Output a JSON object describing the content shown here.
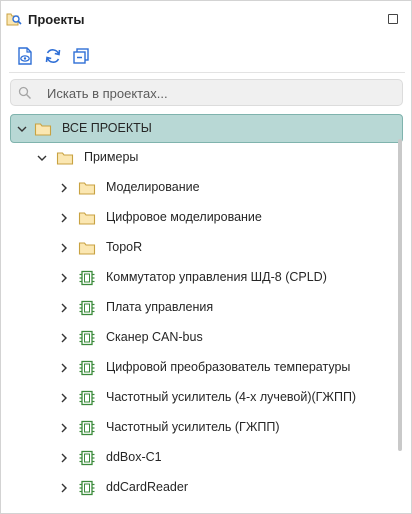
{
  "header": {
    "title": "Проекты"
  },
  "toolbar": {
    "buttons": [
      {
        "icon": "document-eye-icon"
      },
      {
        "icon": "refresh-icon"
      },
      {
        "icon": "collapse-all-icon"
      }
    ]
  },
  "search": {
    "placeholder": "Искать в проектах...",
    "value": ""
  },
  "colors": {
    "accent_blue": "#2f6fd6",
    "root_selection_bg": "#b8d8d5",
    "root_selection_border": "#7fb3ad",
    "folder_fill": "#fbe7b2",
    "folder_stroke": "#c8a241",
    "project_green": "#3a8a3a"
  },
  "tree": {
    "root": {
      "label": "ВСЕ ПРОЕКТЫ",
      "expanded": true
    },
    "group": {
      "label": "Примеры",
      "expanded": true
    },
    "items": [
      {
        "label": "Моделирование",
        "kind": "folder"
      },
      {
        "label": "Цифровое моделирование",
        "kind": "folder"
      },
      {
        "label": "TopoR",
        "kind": "folder"
      },
      {
        "label": "Коммутатор управления ШД-8 (CPLD)",
        "kind": "project"
      },
      {
        "label": "Плата управления",
        "kind": "project"
      },
      {
        "label": "Сканер CAN-bus",
        "kind": "project"
      },
      {
        "label": "Цифровой преобразователь температуры",
        "kind": "project"
      },
      {
        "label": "Частотный усилитель (4-х лучевой)(ГЖПП)",
        "kind": "project"
      },
      {
        "label": "Частотный усилитель (ГЖПП)",
        "kind": "project"
      },
      {
        "label": "ddBox-C1",
        "kind": "project"
      },
      {
        "label": "ddCardReader",
        "kind": "project"
      }
    ]
  }
}
